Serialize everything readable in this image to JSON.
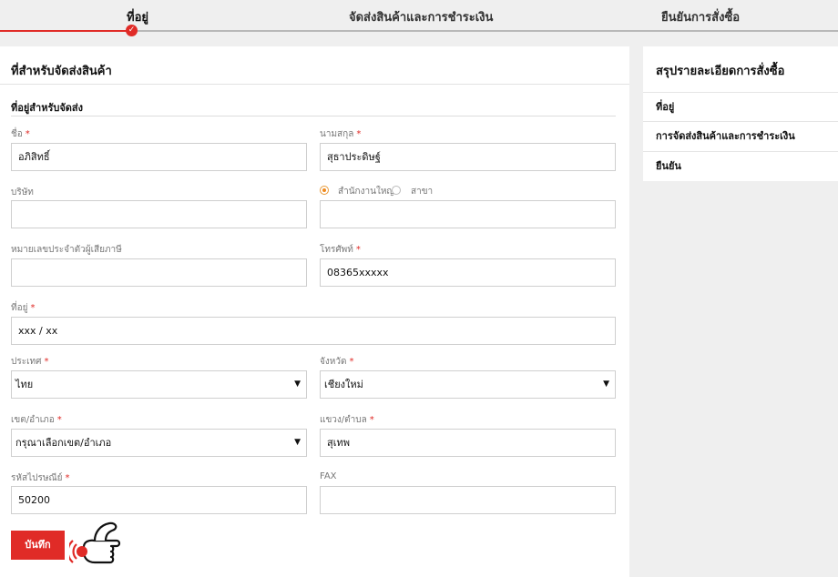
{
  "steps": [
    {
      "label": "ที่อยู่",
      "active": true
    },
    {
      "label": "จัดส่งสินค้าและการชำระเงิน",
      "active": false
    },
    {
      "label": "ยืนยันการสั่งซื้อ",
      "active": false
    }
  ],
  "form": {
    "title": "ที่สำหรับจัดส่งสินค้า",
    "section_title": "ที่อยู่สำหรับจัดส่ง",
    "required_mark": "*",
    "first_name": {
      "label": "ชื่อ",
      "value": "อภิสิทธิ์"
    },
    "last_name": {
      "label": "นามสกุล",
      "value": "สุธาประดิษฐ์"
    },
    "company": {
      "label": "บริษัท",
      "value": ""
    },
    "branch": {
      "head_office_label": "สำนักงานใหญ่",
      "branch_label": "สาขา",
      "selected": "head_office",
      "value": ""
    },
    "tax_id": {
      "label": "หมายเลขประจำตัวผู้เสียภาษี",
      "value": ""
    },
    "phone": {
      "label": "โทรศัพท์",
      "value": "08365xxxxx"
    },
    "address": {
      "label": "ที่อยู่",
      "value": "xxx / xx"
    },
    "country": {
      "label": "ประเทศ",
      "value": "ไทย"
    },
    "province": {
      "label": "จังหวัด",
      "value": "เชียงใหม่"
    },
    "district": {
      "label": "เขต/อำเภอ",
      "value": "กรุณาเลือกเขต/อำเภอ"
    },
    "subdistrict": {
      "label": "แขวง/ตำบล",
      "value": "สุเทพ"
    },
    "postcode": {
      "label": "รหัสไปรษณีย์",
      "value": "50200"
    },
    "fax": {
      "label": "FAX",
      "value": ""
    },
    "save_label": "บันทึก"
  },
  "sidebar": {
    "title": "สรุปรายละเอียดการสั่งซื้อ",
    "items": [
      "ที่อยู่",
      "การจัดส่งสินค้าและการชำระเงิน",
      "ยืนยัน"
    ]
  },
  "colors": {
    "accent": "#e02b27",
    "radio": "#f08a1e"
  }
}
